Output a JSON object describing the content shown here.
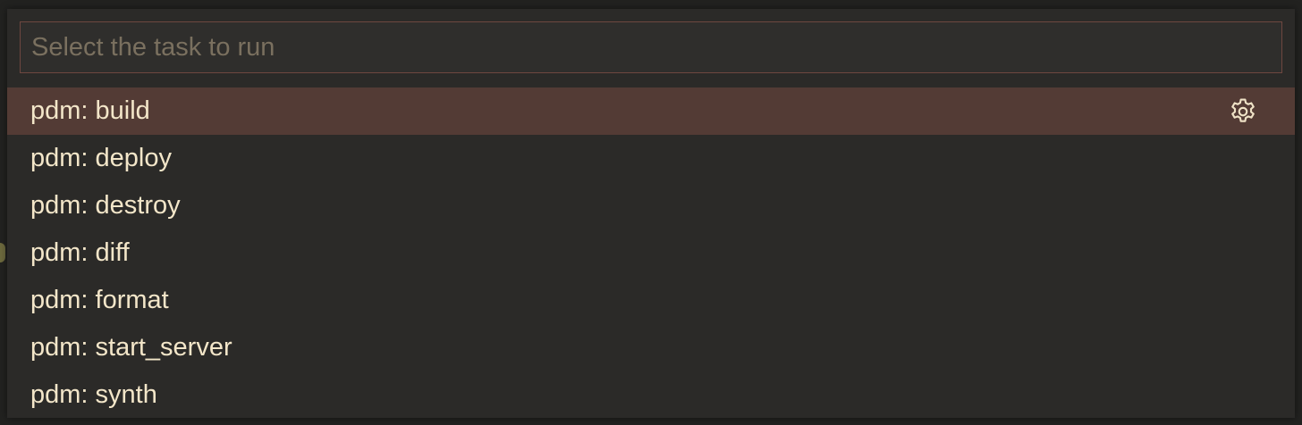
{
  "quick_pick": {
    "placeholder": "Select the task to run",
    "value": "",
    "items": [
      {
        "label": "pdm: build",
        "selected": true,
        "action_icon": "gear-icon"
      },
      {
        "label": "pdm: deploy"
      },
      {
        "label": "pdm: destroy"
      },
      {
        "label": "pdm: diff"
      },
      {
        "label": "pdm: format"
      },
      {
        "label": "pdm: start_server"
      },
      {
        "label": "pdm: synth"
      }
    ]
  },
  "colors": {
    "background": "#2b2a28",
    "selected_row": "#533b35",
    "input_border": "#6e4740",
    "text": "#f3e6c9",
    "placeholder": "#7a705f"
  }
}
